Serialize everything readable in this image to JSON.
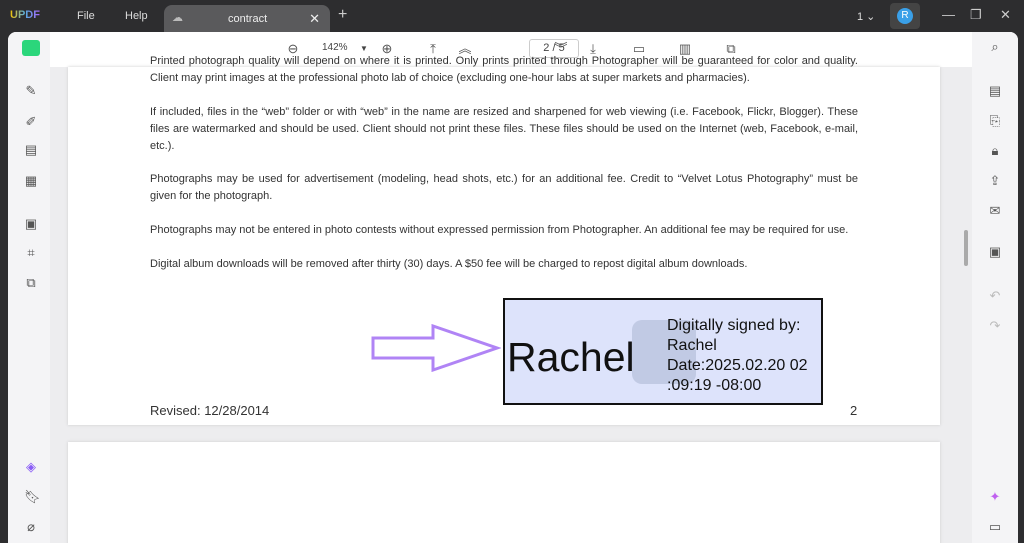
{
  "app": {
    "logo": "UPDF",
    "menu": [
      "File",
      "Help"
    ],
    "tab": "contract",
    "page_indicator": "1",
    "avatar": "R"
  },
  "toolbar": {
    "zoom": "142%",
    "page": "2 / 5"
  },
  "document": {
    "paragraphs": [
      "Printed photograph quality will depend on where it is printed. Only prints printed through Photographer will be guaranteed for color and quality. Client may print images at the professional photo lab of choice (excluding one-hour labs at super markets and pharmacies).",
      "If included, files in the “web” folder or with “web” in the name are resized and sharpened for web viewing (i.e. Facebook, Flickr, Blogger). These files are watermarked and should be used. Client should not print these files. These files should be used on the Internet (web, Facebook, e-mail, etc.).",
      "Photographs may be used for advertisement (modeling, head shots, etc.) for an additional fee. Credit to “Velvet Lotus Photography” must be given for the photograph.",
      "Photographs may not be entered in photo contests without expressed permission from Photographer. An additional fee may be required for use.",
      "Digital album downloads will be removed after thirty (30) days. A $50 fee will be charged to repost digital album downloads."
    ],
    "revised": "Revised: 12/28/2014",
    "page_number": "2",
    "signature": {
      "name": "Rachel",
      "line1": "Digitally signed by:",
      "line2": "Rachel",
      "line3": "Date:2025.02.20 02",
      "line4": ":09:19 -08:00"
    }
  }
}
